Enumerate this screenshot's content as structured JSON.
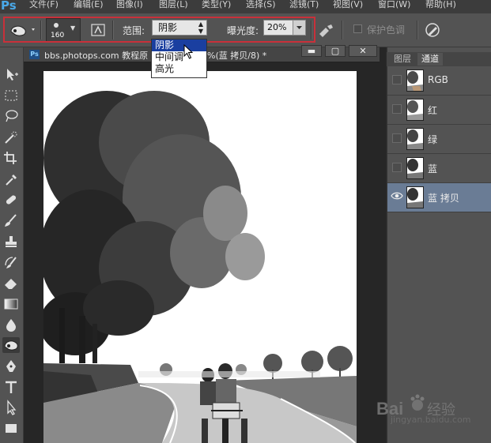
{
  "app": {
    "logo": "Ps"
  },
  "menu": [
    "文件(F)",
    "编辑(E)",
    "图像(I)",
    "图层(L)",
    "类型(Y)",
    "选择(S)",
    "滤镜(T)",
    "视图(V)",
    "窗口(W)",
    "帮助(H)"
  ],
  "options": {
    "brush_size": "160",
    "range_label": "范围:",
    "range_value": "阴影",
    "exposure_label": "曝光度:",
    "exposure_value": "20%",
    "protect_label": "保护色调"
  },
  "dropdown": {
    "options": [
      "阴影",
      "中间调",
      "高光"
    ],
    "selected": "阴影"
  },
  "document": {
    "title": "bbs.photops.com 教程原",
    "title_tail": "%(蓝 拷贝/8) *"
  },
  "window_buttons": {
    "minimize": "▬",
    "restore": "▢",
    "close": "✕"
  },
  "panel": {
    "tabs": [
      "图层",
      "通道"
    ],
    "active_tab": "通道",
    "channels": [
      {
        "name": "RGB",
        "visible": false,
        "active": false
      },
      {
        "name": "红",
        "visible": false,
        "active": false
      },
      {
        "name": "绿",
        "visible": false,
        "active": false
      },
      {
        "name": "蓝",
        "visible": false,
        "active": false
      },
      {
        "name": "蓝 拷贝",
        "visible": true,
        "active": true
      }
    ]
  },
  "watermark": {
    "text": "jingyan.baidu.com",
    "logo": "Baidu 经验"
  },
  "colors": {
    "highlight_border": "#c9303a",
    "selected_item": "#1a3fa0",
    "active_layer": "#6a7c95"
  }
}
